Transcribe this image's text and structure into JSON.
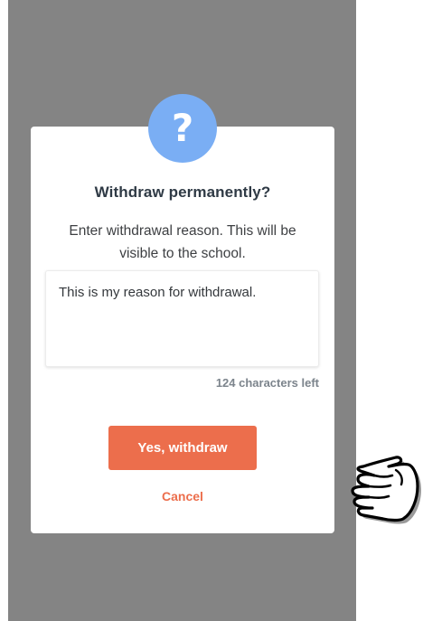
{
  "dialog": {
    "icon": "question-mark-icon",
    "icon_glyph": "?",
    "title": "Withdraw permanently?",
    "message": "Enter withdrawal reason. This will be visible to the school.",
    "reason_value": "This is my reason for withdrawal.",
    "characters_left": "124 characters left",
    "confirm_label": "Yes, withdraw",
    "cancel_label": "Cancel"
  },
  "overlay": {
    "pointer_icon": "hand-pointer-icon"
  },
  "colors": {
    "backdrop": "#848484",
    "icon_bg": "#7aaef4",
    "accent": "#ec6e4c",
    "title": "#2f3a45",
    "muted": "#7c848c"
  }
}
